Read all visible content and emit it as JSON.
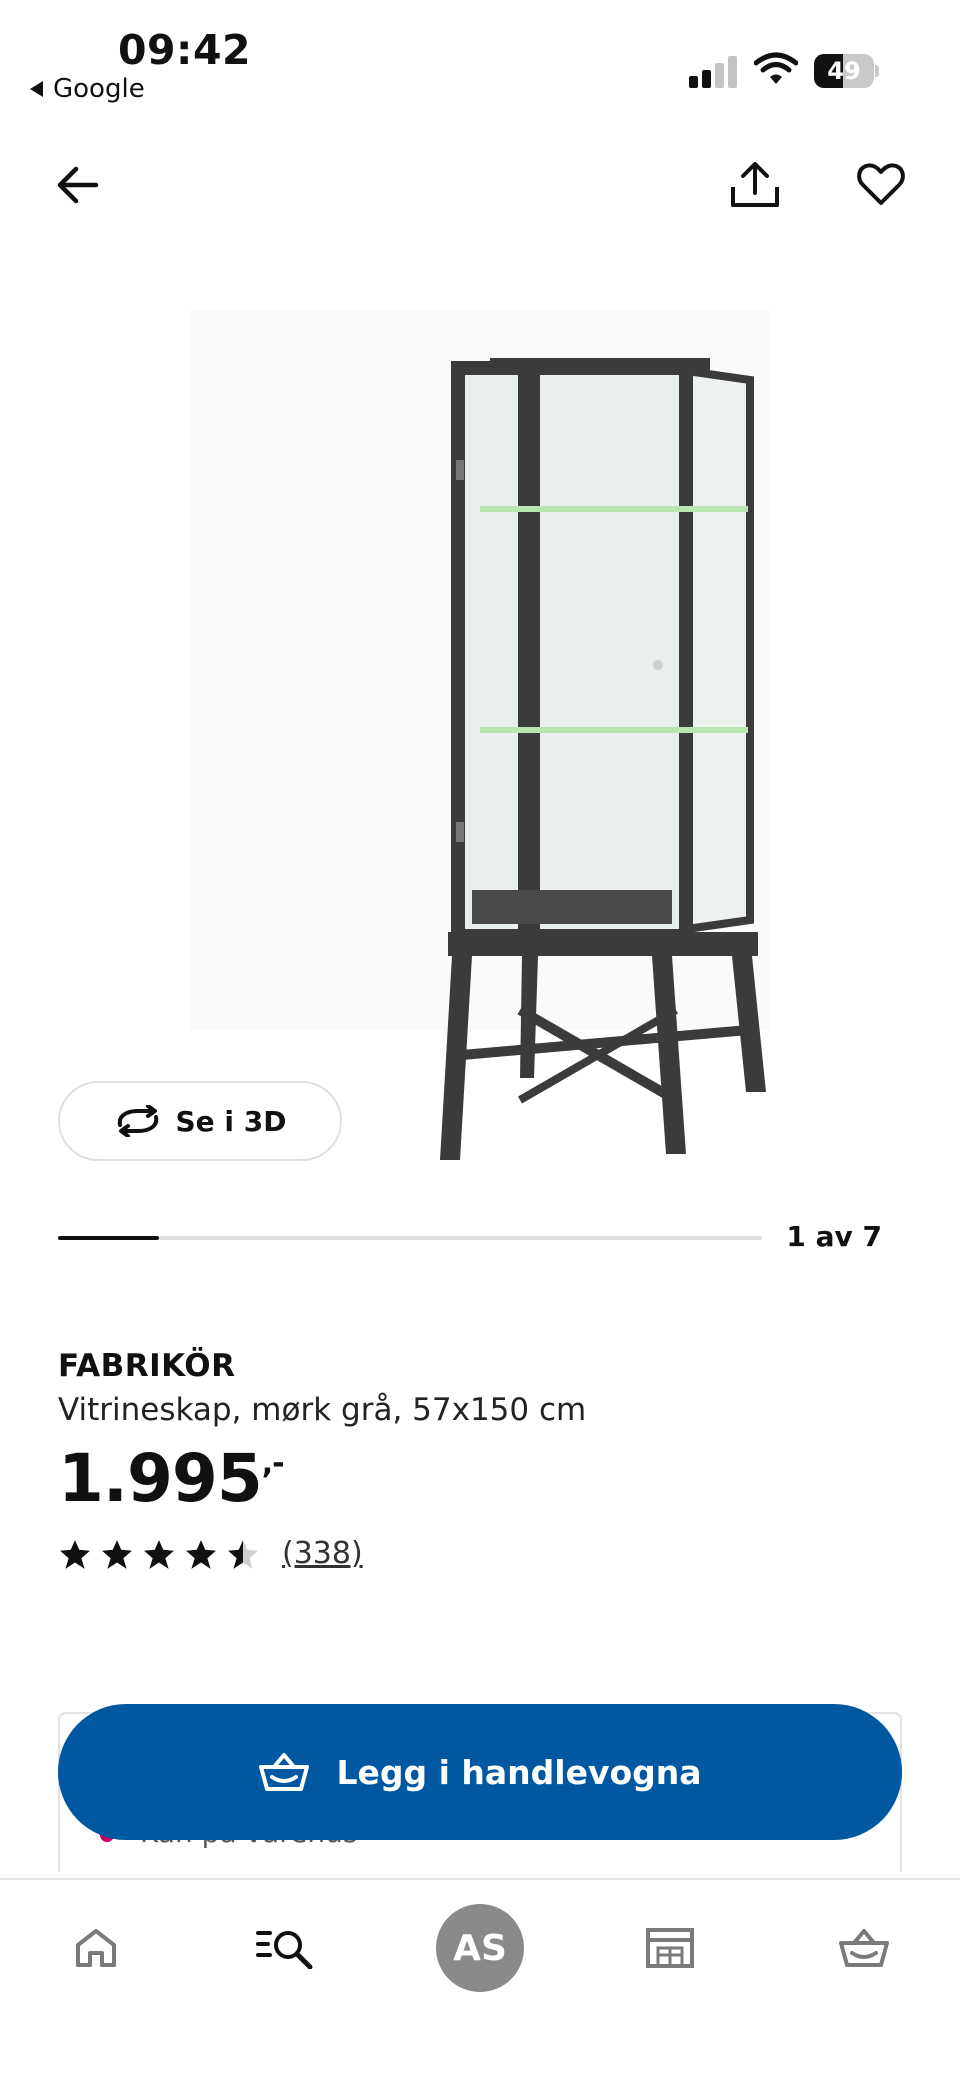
{
  "status_bar": {
    "time": "09:42",
    "back_app": "Google",
    "battery": "49",
    "battery_level": 0.49
  },
  "nav": {
    "back_icon": "arrow-left-icon",
    "share_icon": "share-icon",
    "favorite_icon": "heart-icon"
  },
  "gallery": {
    "view_3d_label": "Se i 3D",
    "page_indicator": "1 av 7",
    "current_page": 1,
    "total_pages": 7
  },
  "product": {
    "brand": "FABRIKÖR",
    "description": "Vitrineskap, mørk grå, 57x150 cm",
    "price": "1.995",
    "price_suffix": ",-",
    "rating": 4.5,
    "review_count": "(338)"
  },
  "cart": {
    "add_label": "Legg i handlevogna",
    "card_text": "Kan på varehus"
  },
  "tabbar": {
    "items": [
      {
        "name": "home",
        "icon": "home-icon"
      },
      {
        "name": "search",
        "icon": "search-icon"
      },
      {
        "name": "profile",
        "label": "AS"
      },
      {
        "name": "stores",
        "icon": "store-icon"
      },
      {
        "name": "cart",
        "icon": "basket-icon"
      }
    ]
  },
  "colors": {
    "brand_blue": "#0058a3",
    "avatar_gray": "#8a8a8a",
    "text": "#111111"
  }
}
